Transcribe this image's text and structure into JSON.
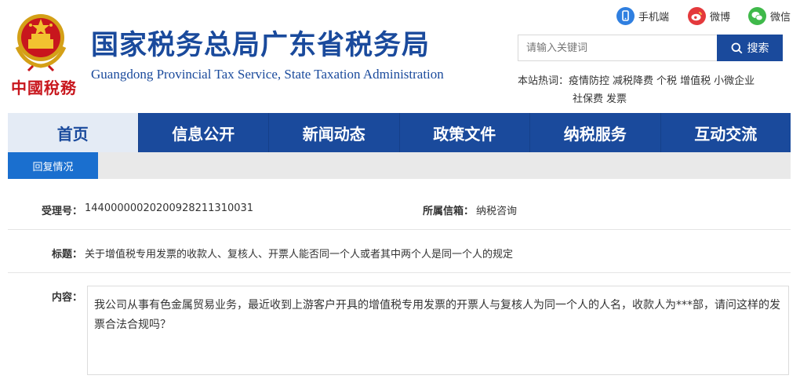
{
  "header": {
    "logo_text": "中國稅務",
    "title_cn": "国家税务总局广东省税务局",
    "title_en": "Guangdong Provincial Tax Service, State Taxation Administration",
    "social": [
      {
        "label": "手机端",
        "icon": "mobile-icon",
        "color": "#2f7fe0"
      },
      {
        "label": "微博",
        "icon": "weibo-icon",
        "color": "#e4393c"
      },
      {
        "label": "微信",
        "icon": "wechat-icon",
        "color": "#3fb94a"
      }
    ],
    "search": {
      "placeholder": "请输入关键词",
      "button_label": "搜索"
    },
    "hot": {
      "label": "本站热词：",
      "items": [
        "疫情防控",
        "减税降费",
        "个税",
        "增值税",
        "小微企业",
        "社保费",
        "发票"
      ]
    }
  },
  "nav": {
    "items": [
      "首页",
      "信息公开",
      "新闻动态",
      "政策文件",
      "纳税服务",
      "互动交流"
    ],
    "active_index": 0
  },
  "subnav": {
    "tab_label": "回复情况"
  },
  "detail": {
    "accept_no_label": "受理号：",
    "accept_no": "14400000020200928211310031",
    "category_label": "所属信箱：",
    "category": "纳税咨询",
    "title_label": "标题：",
    "title": "关于增值税专用发票的收款人、复核人、开票人能否同一个人或者其中两个人是同一个人的规定",
    "content_label": "内容：",
    "content": "我公司从事有色金属贸易业务，最近收到上游客户开具的增值税专用发票的开票人与复核人为同一个人的人名，收款人为***部，请问这样的发票合法合规吗？"
  },
  "colors": {
    "brand_blue": "#1a4a9c",
    "tab_blue": "#1a6fcf",
    "emblem_red": "#c8161d"
  }
}
